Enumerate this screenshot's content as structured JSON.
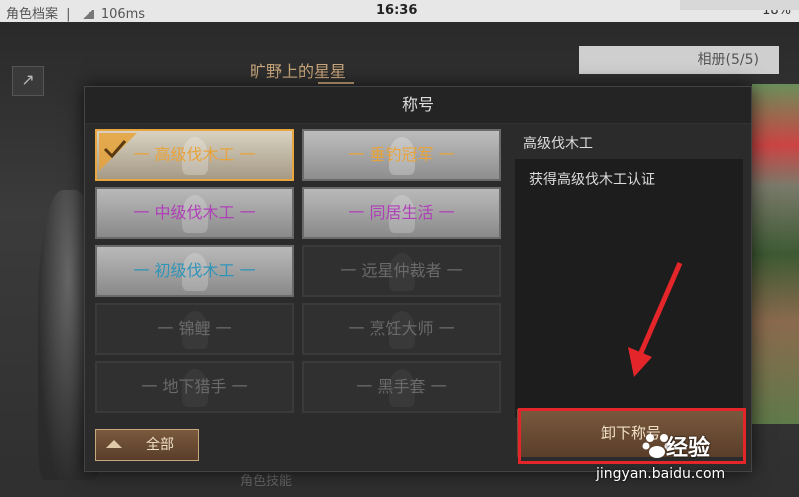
{
  "status_bar": {
    "app_label": "角色档案",
    "ping": "106ms",
    "time": "16:36",
    "battery": "18%"
  },
  "profile": {
    "name": "旷野上的星星",
    "album_tab": "相册(5/5)",
    "bottom_hint": "角色技能"
  },
  "modal": {
    "title": "称号",
    "titles": [
      {
        "label": "一 高级伐木工 一",
        "state": "selected",
        "color": "#e8a33a"
      },
      {
        "label": "一 垂钓冠军 一",
        "state": "unlocked",
        "color": "#e8a33a"
      },
      {
        "label": "一 中级伐木工 一",
        "state": "unlocked",
        "color": "#b040b8"
      },
      {
        "label": "一 同居生活 一",
        "state": "unlocked",
        "color": "#b040b8"
      },
      {
        "label": "一 初级伐木工 一",
        "state": "unlocked",
        "color": "#2f95b8"
      },
      {
        "label": "一 远星仲裁者 一",
        "state": "locked",
        "color": "#6a6a6a"
      },
      {
        "label": "一 锦鲤 一",
        "state": "locked",
        "color": "#6a6a6a"
      },
      {
        "label": "一 烹饪大师 一",
        "state": "locked",
        "color": "#6a6a6a"
      },
      {
        "label": "一 地下猎手 一",
        "state": "locked",
        "color": "#6a6a6a"
      },
      {
        "label": "一 黑手套 一",
        "state": "locked",
        "color": "#6a6a6a"
      }
    ],
    "detail": {
      "title": "高级伐木工",
      "description": "获得高级伐木工认证"
    },
    "all_button": "全部",
    "unequip_button": "卸下称号"
  },
  "watermark": {
    "brand": "经验",
    "url": "jingyan.baidu.com"
  },
  "colors": {
    "accent_gold": "#e8a33a",
    "accent_purple": "#b040b8",
    "accent_blue": "#2f95b8",
    "highlight_red": "#e4252a",
    "button_brown": "#6a4a32"
  }
}
